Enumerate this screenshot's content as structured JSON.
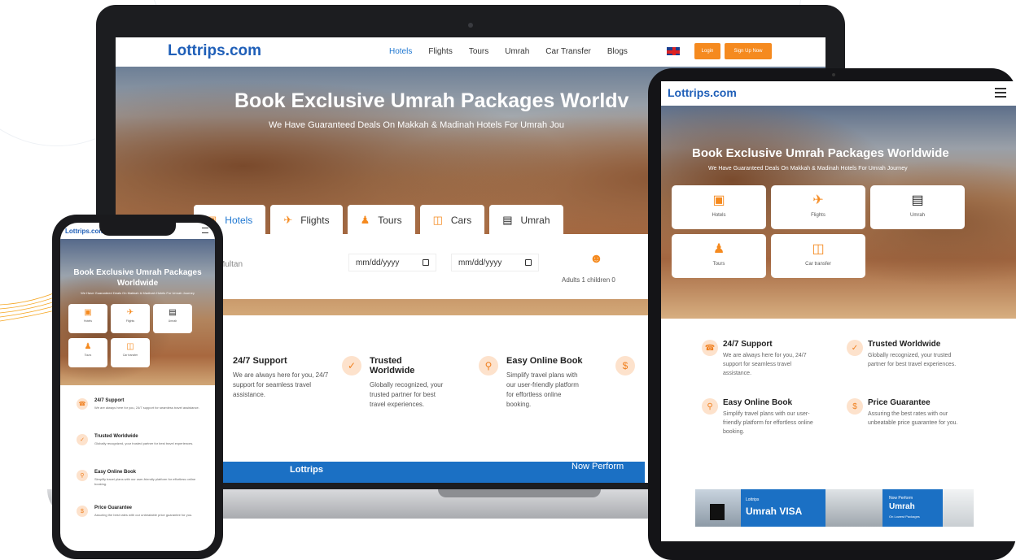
{
  "brand": {
    "name": "Lottrips.com",
    "color": "#1f5fb8",
    "accent": "#f58a1f"
  },
  "nav": {
    "items": [
      {
        "label": "Hotels",
        "active": true
      },
      {
        "label": "Flights",
        "active": false
      },
      {
        "label": "Tours",
        "active": false
      },
      {
        "label": "Umrah",
        "active": false
      },
      {
        "label": "Car Transfer",
        "active": false
      },
      {
        "label": "Blogs",
        "active": false
      }
    ],
    "flag_icon": "uk-flag-icon",
    "login_label": "Login",
    "signup_label": "Sign Up Now"
  },
  "hero": {
    "title_desktop": "Book Exclusive Umrah Packages Worldv",
    "subtitle_desktop": "We Have Guaranteed Deals On Makkah & Madinah Hotels For Umrah Jou",
    "title_full": "Book Exclusive Umrah Packages Worldwide",
    "subtitle_full": "We Have Guaranteed Deals On Makkah & Madinah Hotels For Umrah Journey",
    "title_phone": "Book Exclusive Umrah Packages Worldwide"
  },
  "search": {
    "tabs": [
      {
        "label": "Hotels",
        "icon": "hotel-icon",
        "active": true
      },
      {
        "label": "Flights",
        "icon": "plane-icon",
        "active": false
      },
      {
        "label": "Tours",
        "icon": "hiker-icon",
        "active": false
      },
      {
        "label": "Cars",
        "icon": "car-icon",
        "active": false
      },
      {
        "label": "Umrah",
        "icon": "book-icon",
        "active": false
      }
    ],
    "destination_value": "Multan",
    "checkin_placeholder": "mm/dd/yyyy",
    "checkout_placeholder": "mm/dd/yyyy",
    "guests_label": "Adults 1 children 0"
  },
  "categories": [
    {
      "label": "Hotels",
      "icon": "hotel-icon"
    },
    {
      "label": "Flights",
      "icon": "plane-icon"
    },
    {
      "label": "Umrah",
      "icon": "book-icon"
    },
    {
      "label": "Tours",
      "icon": "hiker-icon"
    },
    {
      "label": "Car transfer",
      "icon": "car-icon"
    }
  ],
  "features": [
    {
      "title": "24/7 Support",
      "text_desktop": "We are always here for you, 24/7 support for seamless travel assistance.",
      "text_tablet": "We are always here for you, 24/7 support for seamless travel assistance.",
      "icon": "support-icon"
    },
    {
      "title": "Trusted Worldwide",
      "text_desktop": "Globally recognized, your trusted partner for best travel experiences.",
      "text_tablet": "Globally recognized, your trusted partner for best travel experiences.",
      "icon": "trust-icon"
    },
    {
      "title": "Easy Online Book",
      "text_desktop": "Simplify travel plans with our user-friendly platform for effortless online booking.",
      "text_tablet": "Simplify travel plans with our user-friendly platform for effortless online booking.",
      "icon": "search-icon"
    },
    {
      "title": "Price Guarantee",
      "text_desktop": "Assuring the best rates with our unbeatable price guarantee for you.",
      "text_tablet": "Assuring the best rates with our unbeatable price guarantee for you.",
      "icon": "price-icon"
    }
  ],
  "promo": {
    "desktop_left": "Lottrips",
    "desktop_right": "Now Perform",
    "tablet_small1": "Lottrips",
    "tablet_big1": "Umrah VISA",
    "tablet_small2": "Now Perform",
    "tablet_big2": "Umrah",
    "tablet_small3": "On Lowest Packages"
  }
}
